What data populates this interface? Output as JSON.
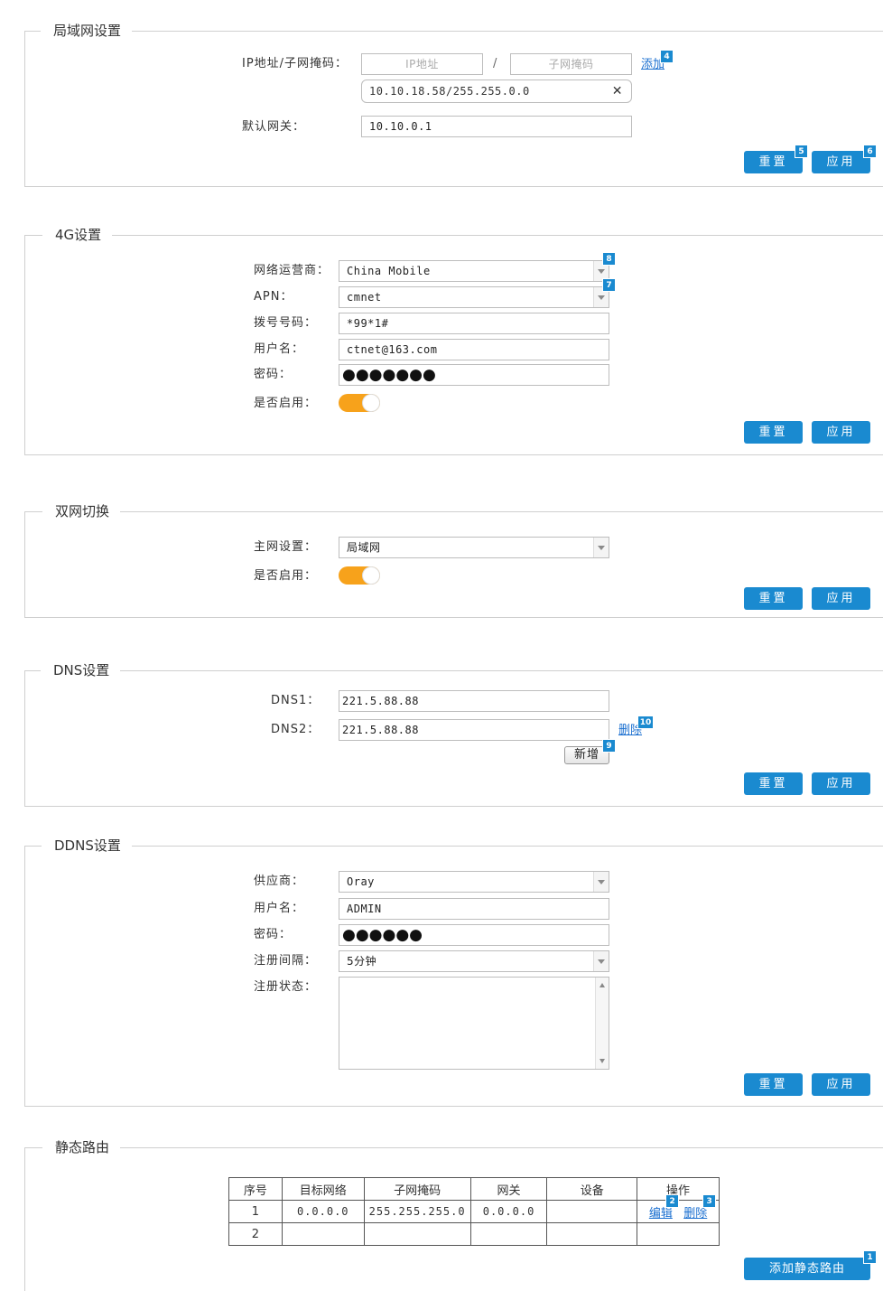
{
  "lan": {
    "legend": "局域网设置",
    "ip_mask_label": "IP地址/子网掩码：",
    "ip_placeholder": "IP地址",
    "slash": "/",
    "mask_placeholder": "子网掩码",
    "add_link": "添加",
    "add_badge": "4",
    "entry": "10.10.18.58/255.255.0.0",
    "remove_glyph": "✕",
    "gateway_label": "默认网关：",
    "gateway_value": "10.10.0.1",
    "reset": "重置",
    "reset_badge": "5",
    "apply": "应用",
    "apply_badge": "6"
  },
  "g4": {
    "legend": "4G设置",
    "operator_label": "网络运营商：",
    "operator_value": "China Mobile",
    "operator_badge": "8",
    "apn_label": "APN：",
    "apn_value": "cmnet",
    "apn_badge": "7",
    "dial_label": "拨号号码：",
    "dial_value": "*99*1#",
    "user_label": "用户名：",
    "user_value": "ctnet@163.com",
    "pwd_label": "密码：",
    "pwd_value": "●●●●●●●",
    "enable_label": "是否启用：",
    "enabled": true,
    "reset": "重置",
    "apply": "应用"
  },
  "dual": {
    "legend": "双网切换",
    "main_label": "主网设置：",
    "main_value": "局域网",
    "enable_label": "是否启用：",
    "enabled": true,
    "reset": "重置",
    "apply": "应用"
  },
  "dns": {
    "legend": "DNS设置",
    "dns1_label": "DNS1：",
    "dns1_value": "221.5.88.88",
    "dns2_label": "DNS2：",
    "dns2_value": "221.5.88.88",
    "delete_link": "删除",
    "delete_badge": "10",
    "add_button": "新增",
    "add_badge": "9",
    "reset": "重置",
    "apply": "应用"
  },
  "ddns": {
    "legend": "DDNS设置",
    "provider_label": "供应商：",
    "provider_value": "Oray",
    "user_label": "用户名：",
    "user_value": "ADMIN",
    "pwd_label": "密码：",
    "pwd_value": "●●●●●●",
    "interval_label": "注册间隔：",
    "interval_value": "5分钟",
    "status_label": "注册状态：",
    "reset": "重置",
    "apply": "应用"
  },
  "routes": {
    "legend": "静态路由",
    "headers": [
      "序号",
      "目标网络",
      "子网掩码",
      "网关",
      "设备",
      "操作"
    ],
    "rows": [
      {
        "index": "1",
        "target": "0.0.0.0",
        "mask": "255.255.255.0",
        "gateway": "0.0.0.0",
        "device": "",
        "edit": "编辑",
        "edit_badge": "2",
        "delete": "删除",
        "delete_badge": "3"
      },
      {
        "index": "2",
        "target": "",
        "mask": "",
        "gateway": "",
        "device": ""
      }
    ],
    "add_button": "添加静态路由",
    "add_badge": "1"
  },
  "colors": {
    "accent": "#1a8ad0",
    "toggle_on": "#f7a21b",
    "link": "#1a6fd0",
    "border": "#cfcfcf"
  }
}
